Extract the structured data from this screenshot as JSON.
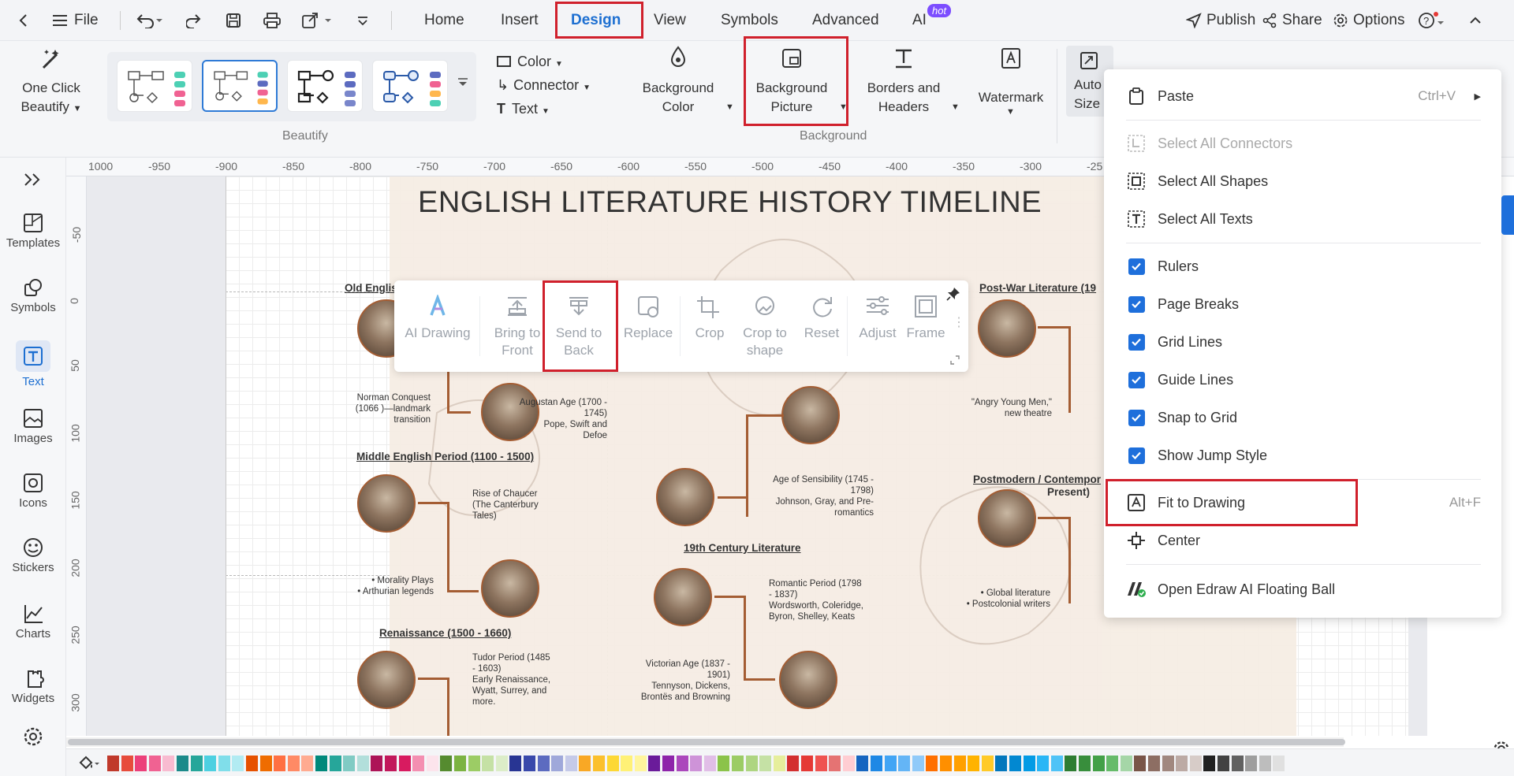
{
  "topbar": {
    "file_label": "File",
    "tabs": [
      "Home",
      "Insert",
      "Design",
      "View",
      "Symbols",
      "Advanced",
      "AI"
    ],
    "active_tab": "Design",
    "ai_badge": "hot",
    "publish": "Publish",
    "share": "Share",
    "options": "Options"
  },
  "ribbon": {
    "beautify": {
      "one_click_line1": "One Click",
      "one_click_line2": "Beautify",
      "group_label": "Beautify"
    },
    "style_menu": {
      "color": "Color",
      "connector": "Connector",
      "text": "Text"
    },
    "background": {
      "bg_color_line1": "Background",
      "bg_color_line2": "Color",
      "bg_picture_line1": "Background",
      "bg_picture_line2": "Picture",
      "borders_line1": "Borders and",
      "borders_line2": "Headers",
      "watermark": "Watermark",
      "group_label": "Background"
    },
    "auto_size_line1": "Auto",
    "auto_size_line2": "Size"
  },
  "sidebar": {
    "items": [
      {
        "label": "Templates"
      },
      {
        "label": "Symbols"
      },
      {
        "label": "Text"
      },
      {
        "label": "Images"
      },
      {
        "label": "Icons"
      },
      {
        "label": "Stickers"
      },
      {
        "label": "Charts"
      },
      {
        "label": "Widgets"
      }
    ],
    "active": "Text"
  },
  "rulers": {
    "top": [
      "1000",
      "-950",
      "-900",
      "-850",
      "-800",
      "-750",
      "-700",
      "-650",
      "-600",
      "-550",
      "-500",
      "-450",
      "-400",
      "-350",
      "-300",
      "-25"
    ],
    "left": [
      "-50",
      "0",
      "50",
      "100",
      "150",
      "200",
      "250",
      "300"
    ]
  },
  "diagram": {
    "title": "ENGLISH LITERATURE HISTORY TIMELINE",
    "headings": {
      "old_english": "Old English",
      "middle_english": "Middle English Period (1100 - 1500)",
      "renaissance": "Renaissance (1500 - 1660)",
      "nineteenth": "19th Century Literature",
      "post_war": "Post-War Literature (19",
      "postmodern_line1": "Postmodern / Contempor",
      "postmodern_line2": "Present)"
    },
    "texts": {
      "norman": "Norman Conquest (1066 )—landmark transition",
      "chaucer": "Rise of Chaucer (The Canterbury Tales)",
      "morality": "• Morality Plays\n• Arthurian legends",
      "tudor": "Tudor Period (1485 - 1603)\nEarly Renaissance, Wyatt, Surrey, and more.",
      "augustan": "Augustan Age (1700 - 1745)\nPope, Swift and Defoe",
      "sensibility": "Age of Sensibility (1745 - 1798)\nJohnson, Gray, and Pre-romantics",
      "romantic": "Romantic Period (1798 - 1837)\nWordsworth, Coleridge, Byron, Shelley, Keats",
      "victorian": "Victorian Age (1837 - 1901)\nTennyson, Dickens, Brontës and Browning",
      "angry": "\"Angry Young Men,\" new theatre",
      "global": "• Global literature\n• Postcolonial writers"
    }
  },
  "image_toolbar": {
    "items": [
      {
        "line1": "AI Drawing",
        "line2": ""
      },
      {
        "line1": "Bring to",
        "line2": "Front"
      },
      {
        "line1": "Send to",
        "line2": "Back"
      },
      {
        "line1": "Replace",
        "line2": ""
      },
      {
        "line1": "Crop",
        "line2": ""
      },
      {
        "line1": "Crop to",
        "line2": "shape"
      },
      {
        "line1": "Reset",
        "line2": ""
      },
      {
        "line1": "Adjust",
        "line2": ""
      },
      {
        "line1": "Frame",
        "line2": ""
      }
    ]
  },
  "context_menu": {
    "paste": "Paste",
    "paste_shortcut": "Ctrl+V",
    "select_connectors": "Select All Connectors",
    "select_shapes": "Select All Shapes",
    "select_texts": "Select All Texts",
    "rulers": "Rulers",
    "page_breaks": "Page Breaks",
    "grid_lines": "Grid Lines",
    "guide_lines": "Guide Lines",
    "snap_to_grid": "Snap to Grid",
    "show_jump_style": "Show Jump Style",
    "fit_to_drawing": "Fit to Drawing",
    "fit_shortcut": "Alt+F",
    "center": "Center",
    "open_ai_ball": "Open Edraw AI Floating Ball"
  },
  "colors": {
    "accent": "#1d6fd1",
    "highlight": "#d0202c",
    "timeline_line": "#a45d33",
    "palette": [
      "#c0392b",
      "#e74c3c",
      "#ec407a",
      "#f06292",
      "#f8bbd0",
      "#1b8a8a",
      "#26a69a",
      "#4dd0e1",
      "#80deea",
      "#b2ebf2",
      "#e65100",
      "#ef6c00",
      "#ff7043",
      "#ff8a65",
      "#ffab91",
      "#00897b",
      "#26a69a",
      "#80cbc4",
      "#b2dfdb",
      "#ad1457",
      "#c2185b",
      "#d81b60",
      "#f48fb1",
      "#fce4ec",
      "#558b2f",
      "#7cb342",
      "#9ccc65",
      "#c5e1a5",
      "#dcedc8",
      "#283593",
      "#3949ab",
      "#5c6bc0",
      "#9fa8da",
      "#c5cae9",
      "#f9a825",
      "#fbc02d",
      "#fdd835",
      "#fff176",
      "#fff59d",
      "#6a1b9a",
      "#8e24aa",
      "#ab47bc",
      "#ce93d8",
      "#e1bee7",
      "#8bc34a",
      "#9ccc65",
      "#aed581",
      "#c5e1a5",
      "#e6ee9c",
      "#d32f2f",
      "#e53935",
      "#ef5350",
      "#e57373",
      "#ffcdd2",
      "#1565c0",
      "#1e88e5",
      "#42a5f5",
      "#64b5f6",
      "#90caf9",
      "#ff6f00",
      "#ff8f00",
      "#ffa000",
      "#ffb300",
      "#ffca28",
      "#0277bd",
      "#0288d1",
      "#039be5",
      "#29b6f6",
      "#4fc3f7",
      "#2e7d32",
      "#388e3c",
      "#43a047",
      "#66bb6a",
      "#a5d6a7",
      "#795548",
      "#8d6e63",
      "#a1887f",
      "#bcaaa4",
      "#d7ccc8",
      "#212121",
      "#424242",
      "#616161",
      "#9e9e9e",
      "#bdbdbd",
      "#e0e0e0"
    ]
  }
}
